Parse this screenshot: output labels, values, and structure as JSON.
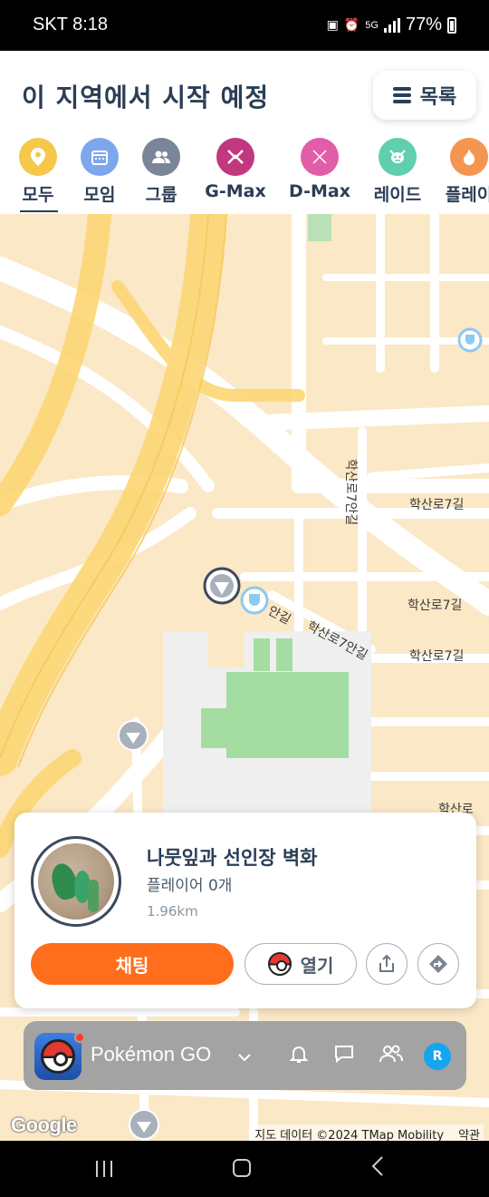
{
  "status_bar": {
    "carrier_time": "SKT 8:18",
    "network": "5G",
    "battery": "77%"
  },
  "header": {
    "title": "이 지역에서 시작 예정",
    "list_button_label": "목록"
  },
  "categories": [
    {
      "label": "모두",
      "color": "#f5c84c",
      "icon": "location-pin-icon",
      "active": true
    },
    {
      "label": "모임",
      "color": "#7ea6ec",
      "icon": "calendar-icon",
      "active": false
    },
    {
      "label": "그룹",
      "color": "#7a8597",
      "icon": "group-icon",
      "active": false
    },
    {
      "label": "G-Max",
      "color": "#c2387e",
      "icon": "gmax-icon",
      "active": false
    },
    {
      "label": "D-Max",
      "color": "#e25da8",
      "icon": "dmax-icon",
      "active": false
    },
    {
      "label": "레이드",
      "color": "#5fcfae",
      "icon": "raid-boss-icon",
      "active": false
    },
    {
      "label": "플레이",
      "color": "#f59552",
      "icon": "flame-icon",
      "active": false
    }
  ],
  "map": {
    "street_labels": [
      "학산로7안길",
      "학산로7길",
      "학산로7길",
      "학산로7길",
      "안길",
      "학산로7안길",
      "학산로7길",
      "학산로"
    ],
    "google_logo": "Google",
    "attribution": "지도 데이터 ©2024 TMap Mobility",
    "terms": "약관"
  },
  "card": {
    "name": "나뭇잎과 선인장 벽화",
    "players": "플레이어 0개",
    "distance": "1.96km",
    "chat_button": "채팅",
    "open_button": "열기"
  },
  "game_bar": {
    "app_name": "Pokémon GO",
    "avatar_initial": "R"
  }
}
